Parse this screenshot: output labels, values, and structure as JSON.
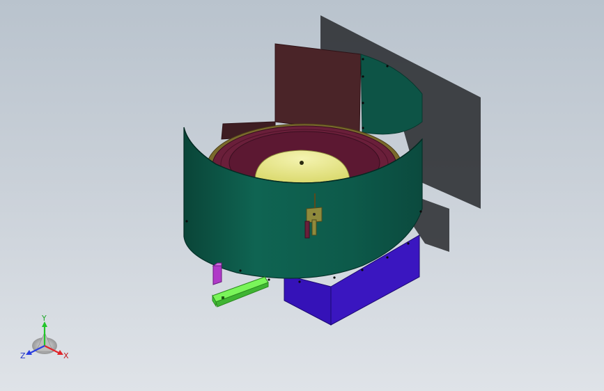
{
  "viewport": {
    "background_top": "#b9c3cd",
    "background_bottom": "#dfe3e8"
  },
  "model": {
    "parts": [
      {
        "id": "back-guard-plate",
        "color": "#4a2428"
      },
      {
        "id": "outer-shroud",
        "color": "#0d5a4c"
      },
      {
        "id": "bowl-track",
        "color": "#6a1f3a"
      },
      {
        "id": "center-cone",
        "color": "#e9ea84"
      },
      {
        "id": "base-box",
        "color": "#3a16c0"
      },
      {
        "id": "discharge-rail",
        "color": "#5ef04a"
      },
      {
        "id": "mount-bracket",
        "color": "#b03ac8"
      },
      {
        "id": "sensor-bracket",
        "color": "#8f8a3c"
      }
    ]
  },
  "triad": {
    "y_label": "Y",
    "x_label": "X",
    "z_label": "Z",
    "y_color": "#22c52a",
    "x_color": "#e0262b",
    "z_color": "#2a3ee0"
  }
}
